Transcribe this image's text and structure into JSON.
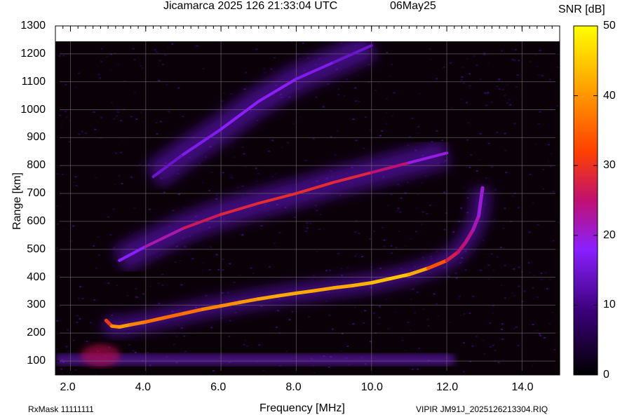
{
  "header": {
    "title": "Jicamarca 2025 126 21:33:04 UTC",
    "date": "06May25"
  },
  "colorbar": {
    "label": "SNR [dB]",
    "ticks": [
      "50",
      "40",
      "30",
      "20",
      "10",
      "0"
    ]
  },
  "footer": {
    "rxmask": "RxMask 11111111",
    "file": "VIPIR  JM91J_2025126213304.RIQ"
  },
  "colors": {
    "background": "#000000",
    "colormap": [
      "#000000",
      "#3a0078",
      "#8a20ff",
      "#c01070",
      "#ff4000",
      "#ffa000",
      "#ffff00"
    ]
  },
  "chart_data": {
    "type": "heatmap",
    "title": "Jicamarca 2025 126 21:33:04 UTC",
    "xlabel": "Frequency [MHz]",
    "ylabel": "Range [km]",
    "colorbar_label": "SNR [dB]",
    "xlim": [
      1.6,
      15.0
    ],
    "ylim": [
      50,
      1300
    ],
    "clim": [
      0,
      50
    ],
    "x_ticks": [
      "2.0",
      "4.0",
      "6.0",
      "8.0",
      "10.0",
      "12.0",
      "14.0"
    ],
    "y_ticks": [
      "100",
      "200",
      "300",
      "400",
      "500",
      "600",
      "700",
      "800",
      "900",
      "1000",
      "1100",
      "1200",
      "1300"
    ],
    "grid": true,
    "series": [
      {
        "name": "",
        "x": [
          2.95,
          3.1,
          3.3,
          3.6,
          4.0,
          4.5,
          5.0,
          5.5,
          6.0,
          6.5,
          7.0,
          7.5,
          8.0,
          8.5,
          9.0,
          9.5,
          10.0,
          10.5,
          11.0,
          11.5,
          12.0,
          12.3,
          12.5,
          12.7,
          12.85,
          12.95
        ],
        "y": [
          245,
          225,
          222,
          230,
          240,
          255,
          270,
          285,
          297,
          310,
          322,
          333,
          343,
          352,
          362,
          370,
          380,
          395,
          410,
          432,
          460,
          490,
          525,
          570,
          620,
          720
        ],
        "snr": [
          25,
          38,
          42,
          40,
          38,
          37,
          37,
          38,
          40,
          40,
          42,
          42,
          43,
          42,
          42,
          43,
          43,
          45,
          45,
          40,
          30,
          25,
          25,
          22,
          20,
          18
        ]
      },
      {
        "name": "",
        "x": [
          3.3,
          4.0,
          5.0,
          6.0,
          7.0,
          8.0,
          9.0,
          10.0,
          11.0,
          12.0
        ],
        "y": [
          460,
          510,
          575,
          625,
          665,
          700,
          740,
          775,
          810,
          845
        ],
        "snr": [
          15,
          18,
          25,
          28,
          30,
          30,
          30,
          28,
          22,
          15
        ]
      },
      {
        "name": "",
        "x": [
          4.2,
          5.0,
          6.0,
          7.0,
          8.0,
          9.0,
          10.0
        ],
        "y": [
          760,
          840,
          930,
          1030,
          1110,
          1170,
          1230
        ],
        "snr": [
          12,
          15,
          16,
          18,
          16,
          15,
          12
        ]
      }
    ]
  }
}
